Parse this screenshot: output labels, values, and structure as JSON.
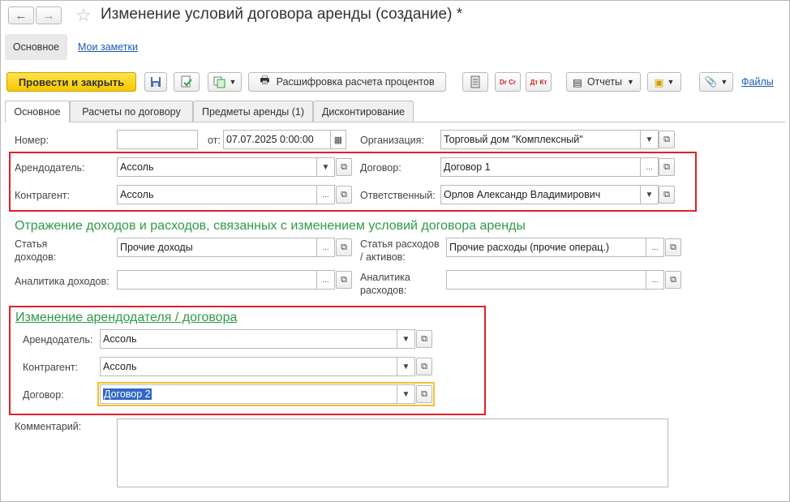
{
  "window": {
    "title": "Изменение условий договора аренды (создание) *"
  },
  "nav": {
    "back": "←",
    "forward": "→",
    "star": "☆"
  },
  "sections_nav": {
    "main": "Основное",
    "notes": "Мои заметки"
  },
  "toolbar": {
    "post_close": "Провести и закрыть",
    "save_icon": "floppy-icon",
    "decode": "Расшифровка расчета процентов",
    "dr_cr": "Dr Cr",
    "dt_kt": "Дт Кт",
    "reports": "Отчеты",
    "files": "Файлы"
  },
  "tabs": [
    {
      "label": "Основное"
    },
    {
      "label": "Расчеты по договору"
    },
    {
      "label": "Предметы аренды (1)"
    },
    {
      "label": "Дисконтирование"
    }
  ],
  "form": {
    "number_label": "Номер:",
    "number_value": "",
    "date_from_label": "от:",
    "date_value": "07.07.2025  0:00:00",
    "org_label": "Организация:",
    "org_value": "Торговый дом \"Комплексный\"",
    "lessor_label": "Арендодатель:",
    "lessor_value": "Ассоль",
    "contract_label": "Договор:",
    "contract_value": "Договор 1",
    "counterparty_label": "Контрагент:",
    "counterparty_value": "Ассоль",
    "responsible_label": "Ответственный:",
    "responsible_value": "Орлов Александр Владимирович"
  },
  "income_section": {
    "title": "Отражение доходов и расходов, связанных с изменением условий договора аренды",
    "income_item_label_1": "Статья",
    "income_item_label_2": "доходов:",
    "income_item_value": "Прочие доходы",
    "expense_item_label_1": "Статья расходов",
    "expense_item_label_2": "/ активов:",
    "expense_item_value": "Прочие расходы (прочие операц.)",
    "income_analytics_label": "Аналитика доходов:",
    "income_analytics_value": "",
    "expense_analytics_label_1": "Аналитика",
    "expense_analytics_label_2": "расходов:",
    "expense_analytics_value": ""
  },
  "change_section": {
    "title": "Изменение арендодателя / договора",
    "lessor_label": "Арендодатель:",
    "lessor_value": "Ассоль",
    "counterparty_label": "Контрагент:",
    "counterparty_value": "Ассоль",
    "contract_label": "Договор:",
    "contract_value": "Договор 2"
  },
  "comment": {
    "label": "Комментарий:",
    "value": ""
  },
  "colors": {
    "accent_yellow": "#f6c800",
    "section_green": "#2e9a47",
    "highlight_red": "#e0202b",
    "link_blue": "#1a5bb5",
    "selection_blue": "#3067c8",
    "focus_yellow": "#f2c12e"
  }
}
